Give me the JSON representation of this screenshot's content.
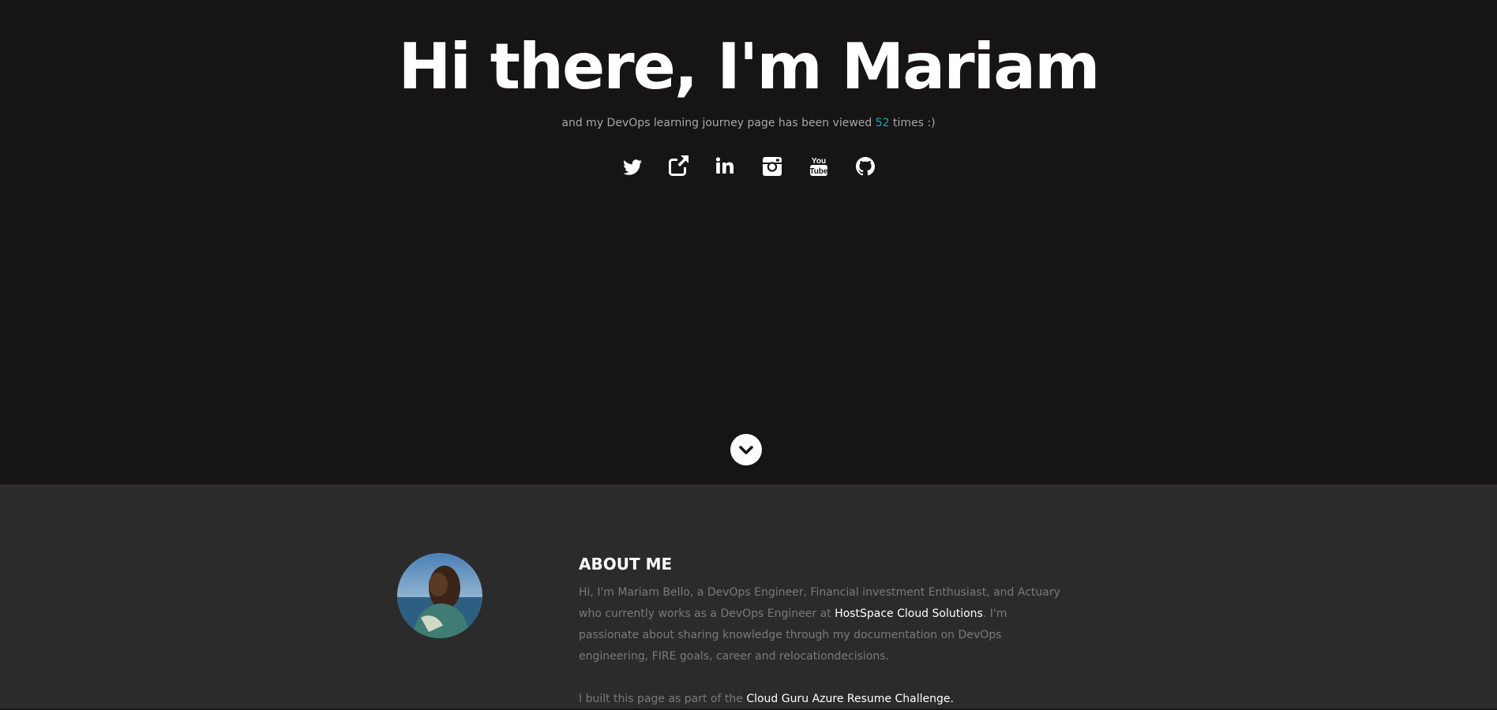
{
  "hero": {
    "title": "Hi there, I'm Mariam",
    "subtitle_before": "and my DevOps learning journey page has been viewed ",
    "view_count": "52",
    "subtitle_after": " times :)",
    "social_icons": [
      "twitter-icon",
      "external-link-icon",
      "linkedin-icon",
      "instagram-icon",
      "youtube-icon",
      "github-icon"
    ],
    "scroll_icon": "chevron-down-icon"
  },
  "about": {
    "heading": "ABOUT ME",
    "para1_before": "Hi, I'm Mariam Bello, a DevOps Engineer, Financial investment Enthusiast, and Actuary who currently works as a DevOps Engineer at ",
    "company_link": "HostSpace Cloud Solutions",
    "para1_after": ". I'm passionate about sharing knowledge through my documentation on DevOps engineering, FIRE goals, career and relocationdecisions.",
    "para2_before": "I built this page as part of the ",
    "challenge_link": "Cloud Guru Azure Resume Challenge."
  },
  "colors": {
    "hero_bg": "#161415",
    "about_bg": "#2b2b2b",
    "accent": "#11abb0",
    "body_text": "#7a7a7a"
  }
}
